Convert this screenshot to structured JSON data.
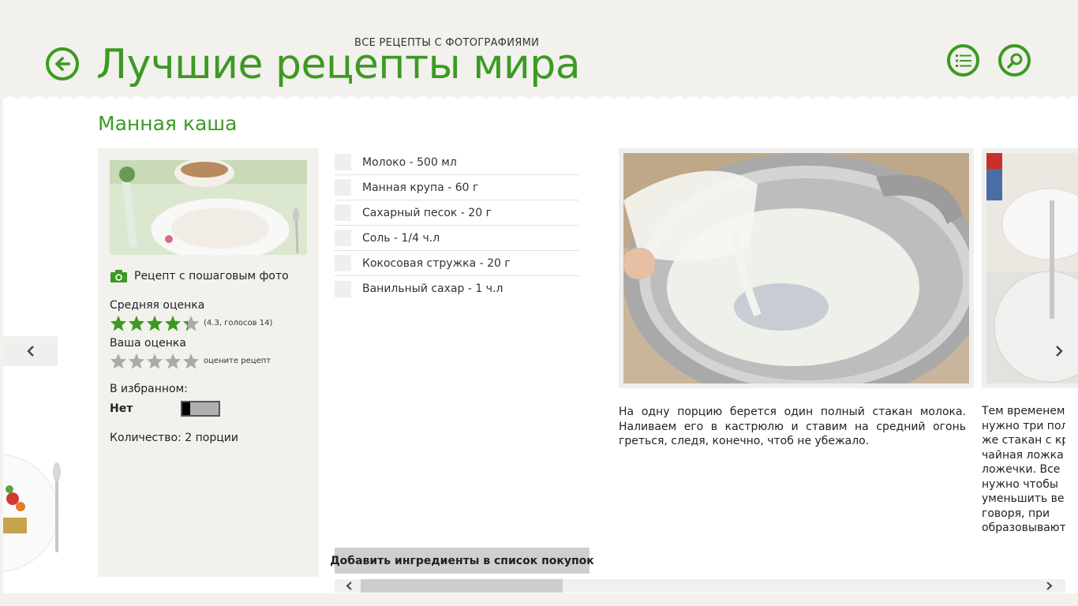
{
  "header": {
    "subtitle": "ВСЕ РЕЦЕПТЫ С ФОТОГРАФИЯМИ",
    "title": "Лучшие рецепты мира"
  },
  "recipe": {
    "title": "Манная каша",
    "step_photo_label": "Рецепт с пошаговым фото",
    "avg_rating_label": "Средняя оценка",
    "avg_rating_value": 4.3,
    "avg_rating_note": "(4.3, голосов 14)",
    "your_rating_label": "Ваша оценка",
    "your_rating_note": "оцените рецепт",
    "favorite_label": "В избранном:",
    "favorite_value": "Нет",
    "quantity": "Количество: 2 порции"
  },
  "ingredients": [
    "Молоко - 500 мл",
    "Манная крупа - 60 г",
    "Сахарный песок - 20 г",
    "Соль - 1/4 ч.л",
    "Кокосовая стружка - 20 г",
    "Ванильный сахар - 1 ч.л"
  ],
  "add_button_label": "Добавить ингредиенты в список покупок",
  "steps": [
    {
      "text": "На одну порцию берется один полный стакан молока. Наливаем его в кастрюлю и ставим на средний огонь греться, следя, конечно, чтоб не убежало."
    },
    {
      "lines": [
        "Тем временем",
        "нужно три полн",
        "же стакан с кру",
        "чайная ложка",
        "ложечки. Все",
        "нужно чтобы",
        "уменьшить ве",
        "говоря, при",
        "образовываютс"
      ]
    }
  ],
  "colors": {
    "accent": "#3c9a22",
    "background": "#f2f1ed",
    "panel": "#ffffff",
    "star_filled": "#3c9a22",
    "star_empty": "#aaaaaa"
  },
  "icons": {
    "back": "arrow-left-circle",
    "list": "list-circle",
    "search": "magnifier-circle",
    "camera": "camera",
    "nav_left": "chevron-left",
    "nav_right": "chevron-right"
  }
}
